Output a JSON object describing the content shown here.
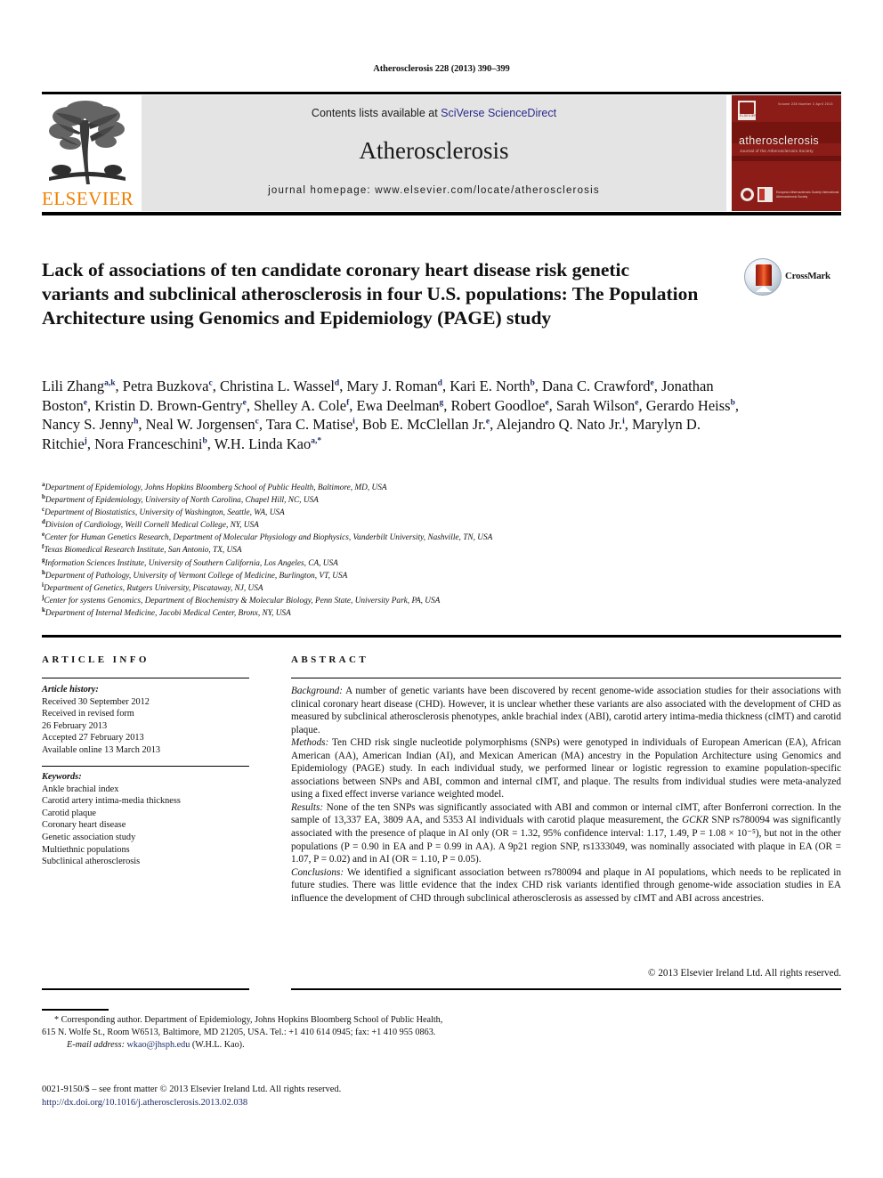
{
  "running_head": "Atherosclerosis 228 (2013) 390–399",
  "masthead": {
    "publisher_logo_label": "ELSEVIER",
    "contents_prefix": "Contents lists available at ",
    "contents_link": "SciVerse ScienceDirect",
    "journal_name": "Atherosclerosis",
    "homepage": "journal homepage: www.elsevier.com/locate/atherosclerosis",
    "cover": {
      "title": "atherosclerosis",
      "subtitle": "Journal of the Atherosclerosis Society",
      "toprow": "Volume 228  Number 2   April 2013",
      "publisher_mark": "ELSEVIER",
      "badge_text": "European Atherosclerosis Society\nInternational Atherosclerosis Society"
    }
  },
  "article": {
    "title": "Lack of associations of ten candidate coronary heart disease risk genetic variants and subclinical atherosclerosis in four U.S. populations: The Population Architecture using Genomics and Epidemiology (PAGE) study",
    "crossmark_label": "CrossMark",
    "authors": [
      {
        "name": "Lili Zhang",
        "sup": "a,k",
        "sep": ", "
      },
      {
        "name": "Petra Buzkova",
        "sup": "c",
        "sep": ", "
      },
      {
        "name": "Christina L. Wassel",
        "sup": "d",
        "sep": ", "
      },
      {
        "name": "Mary J. Roman",
        "sup": "d",
        "sep": ", "
      },
      {
        "name": "Kari E. North",
        "sup": "b",
        "sep": ", "
      },
      {
        "name": "Dana C. Crawford",
        "sup": "e",
        "sep": ", "
      },
      {
        "name": "Jonathan Boston",
        "sup": "e",
        "sep": ", "
      },
      {
        "name": "Kristin D. Brown-Gentry",
        "sup": "e",
        "sep": ", "
      },
      {
        "name": "Shelley A. Cole",
        "sup": "f",
        "sep": ", "
      },
      {
        "name": "Ewa Deelman",
        "sup": "g",
        "sep": ", "
      },
      {
        "name": "Robert Goodloe",
        "sup": "e",
        "sep": ", "
      },
      {
        "name": "Sarah Wilson",
        "sup": "e",
        "sep": ", "
      },
      {
        "name": "Gerardo Heiss",
        "sup": "b",
        "sep": ", "
      },
      {
        "name": "Nancy S. Jenny",
        "sup": "h",
        "sep": ", "
      },
      {
        "name": "Neal W. Jorgensen",
        "sup": "c",
        "sep": ", "
      },
      {
        "name": "Tara C. Matise",
        "sup": "i",
        "sep": ", "
      },
      {
        "name": "Bob E. McClellan Jr.",
        "sup": "e",
        "sep": ", "
      },
      {
        "name": "Alejandro Q. Nato Jr.",
        "sup": "i",
        "sep": ", "
      },
      {
        "name": "Marylyn D. Ritchie",
        "sup": "j",
        "sep": ", "
      },
      {
        "name": "Nora Franceschini",
        "sup": "b",
        "sep": ", "
      },
      {
        "name": "W.H. Linda Kao",
        "sup": "a,*",
        "sep": ""
      }
    ],
    "affiliations": [
      {
        "key": "a",
        "text": "Department of Epidemiology, Johns Hopkins Bloomberg School of Public Health, Baltimore, MD, USA"
      },
      {
        "key": "b",
        "text": "Department of Epidemiology, University of North Carolina, Chapel Hill, NC, USA"
      },
      {
        "key": "c",
        "text": "Department of Biostatistics, University of Washington, Seattle, WA, USA"
      },
      {
        "key": "d",
        "text": "Division of Cardiology, Weill Cornell Medical College, NY, USA"
      },
      {
        "key": "e",
        "text": "Center for Human Genetics Research, Department of Molecular Physiology and Biophysics, Vanderbilt University, Nashville, TN, USA"
      },
      {
        "key": "f",
        "text": "Texas Biomedical Research Institute, San Antonio, TX, USA"
      },
      {
        "key": "g",
        "text": "Information Sciences Institute, University of Southern California, Los Angeles, CA, USA"
      },
      {
        "key": "h",
        "text": "Department of Pathology, University of Vermont College of Medicine, Burlington, VT, USA"
      },
      {
        "key": "i",
        "text": "Department of Genetics, Rutgers University, Piscataway, NJ, USA"
      },
      {
        "key": "j",
        "text": "Center for systems Genomics, Department of Biochemistry & Molecular Biology, Penn State, University Park, PA, USA"
      },
      {
        "key": "k",
        "text": "Department of Internal Medicine, Jacobi Medical Center, Bronx, NY, USA"
      }
    ]
  },
  "article_info": {
    "header": "ARTICLE INFO",
    "history_label": "Article history:",
    "history_lines": [
      "Received 30 September 2012",
      "Received in revised form",
      "26 February 2013",
      "Accepted 27 February 2013",
      "Available online 13 March 2013"
    ],
    "keywords_label": "Keywords:",
    "keywords": [
      "Ankle brachial index",
      "Carotid artery intima-media thickness",
      "Carotid plaque",
      "Coronary heart disease",
      "Genetic association study",
      "Multiethnic populations",
      "Subclinical atherosclerosis"
    ]
  },
  "abstract": {
    "header": "ABSTRACT",
    "background_label": "Background:",
    "background_text": " A number of genetic variants have been discovered by recent genome-wide association studies for their associations with clinical coronary heart disease (CHD). However, it is unclear whether these variants are also associated with the development of CHD as measured by subclinical atherosclerosis phenotypes, ankle brachial index (ABI), carotid artery intima-media thickness (cIMT) and carotid plaque.",
    "methods_label": "Methods:",
    "methods_text": " Ten CHD risk single nucleotide polymorphisms (SNPs) were genotyped in individuals of European American (EA), African American (AA), American Indian (AI), and Mexican American (MA) ancestry in the Population Architecture using Genomics and Epidemiology (PAGE) study. In each individual study, we performed linear or logistic regression to examine population-specific associations between SNPs and ABI, common and internal cIMT, and plaque. The results from individual studies were meta-analyzed using a fixed effect inverse variance weighted model.",
    "results_label": "Results:",
    "results_text_1": " None of the ten SNPs was significantly associated with ABI and common or internal cIMT, after Bonferroni correction. In the sample of 13,337 EA, 3809 AA, and 5353 AI individuals with carotid plaque measurement, the ",
    "results_gene": "GCKR",
    "results_text_2": " SNP rs780094 was significantly associated with the presence of plaque in AI only (OR = 1.32, 95% confidence interval: 1.17, 1.49, P = 1.08 × 10⁻⁵), but not in the other populations (P = 0.90 in EA and P = 0.99 in AA). A 9p21 region SNP, rs1333049, was nominally associated with plaque in EA (OR = 1.07, P = 0.02) and in AI (OR = 1.10, P = 0.05).",
    "conclusions_label": "Conclusions:",
    "conclusions_text": " We identified a significant association between rs780094 and plaque in AI populations, which needs to be replicated in future studies. There was little evidence that the index CHD risk variants identified through genome-wide association studies in EA influence the development of CHD through subclinical atherosclerosis as assessed by cIMT and ABI across ancestries.",
    "copyright": "© 2013 Elsevier Ireland Ltd. All rights reserved."
  },
  "footer": {
    "corresponding_marker": "*",
    "corresponding_text": "Corresponding author. Department of Epidemiology, Johns Hopkins Bloomberg School of Public Health, 615 N. Wolfe St., Room W6513, Baltimore, MD 21205, USA. Tel.: +1 410 614 0945; fax: +1 410 955 0863.",
    "email_label": "E-mail address:",
    "email": "wkao@jhsph.edu",
    "email_owner": "(W.H.L. Kao).",
    "issn_line": "0021-9150/$ – see front matter © 2013 Elsevier Ireland Ltd. All rights reserved.",
    "doi": "http://dx.doi.org/10.1016/j.atherosclerosis.2013.02.038"
  },
  "colors": {
    "elsevier_orange": "#F08000",
    "link_blue": "#1d2c6b",
    "sciencedirect_blue": "#2a2a8c",
    "cover_red": "#8c1c17",
    "band_grey": "#e4e4e4"
  }
}
